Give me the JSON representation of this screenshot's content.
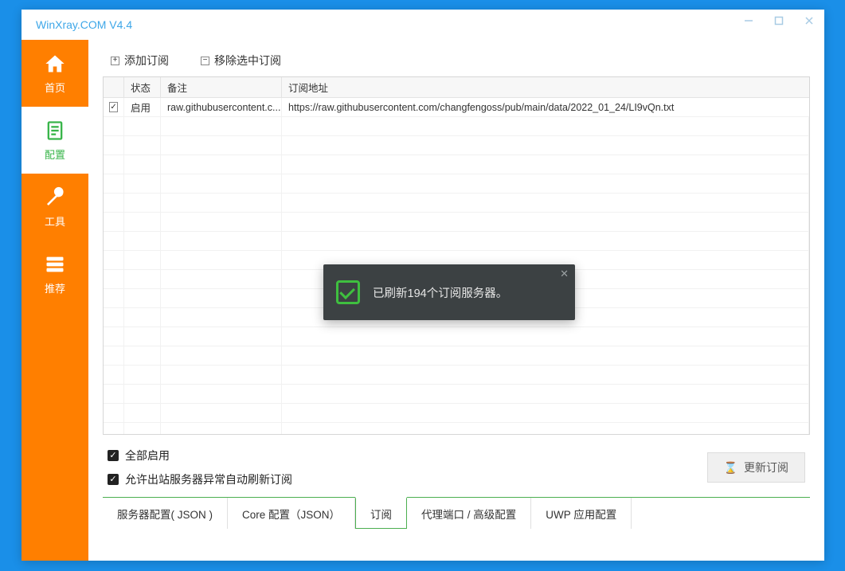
{
  "title": "WinXray.COM   V4.4",
  "sidebar": {
    "items": [
      {
        "label": "首页",
        "icon": "home-icon"
      },
      {
        "label": "配置",
        "icon": "document-icon"
      },
      {
        "label": "工具",
        "icon": "wrench-icon"
      },
      {
        "label": "推荐",
        "icon": "server-icon"
      }
    ]
  },
  "toolbar": {
    "add_label": "添加订阅",
    "remove_label": "移除选中订阅"
  },
  "table": {
    "headers": {
      "status": "状态",
      "note": "备注",
      "url": "订阅地址"
    },
    "rows": [
      {
        "checked": true,
        "status": "启用",
        "note": "raw.githubusercontent.c...",
        "url": "https://raw.githubusercontent.com/changfengoss/pub/main/data/2022_01_24/LI9vQn.txt"
      }
    ]
  },
  "options": {
    "enable_all": "全部启用",
    "auto_refresh": "允许出站服务器异常自动刷新订阅"
  },
  "update_button": "更新订阅",
  "bottom_tabs": [
    "服务器配置( JSON )",
    "Core 配置（JSON）",
    "订阅",
    "代理端口 / 高级配置",
    "UWP 应用配置"
  ],
  "toast": {
    "message": "已刷新194个订阅服务器。"
  }
}
